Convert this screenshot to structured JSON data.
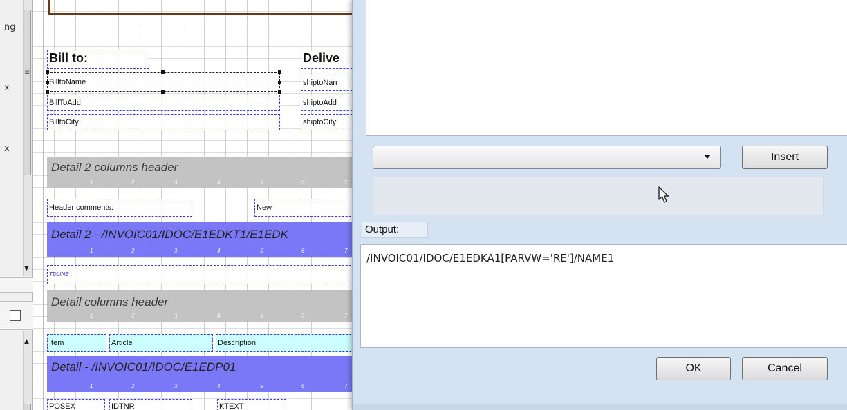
{
  "left_panel": {
    "glyphs": [
      "ng",
      "x",
      "x"
    ]
  },
  "designer": {
    "bill_to_label": "Bill to:",
    "deliver_label": "Delive",
    "bill_fields": [
      "BilltoName",
      "BillToAdd",
      "BilltoCity"
    ],
    "ship_fields": [
      "shiptoNan",
      "shiptoAdd",
      "shiptoCity"
    ],
    "band_detail2_header": "Detail 2 columns header",
    "header_comments_label": "Header comments:",
    "new_label": "New",
    "band_detail2": "Detail 2 - /INVOIC01/IDOC/E1EDKT1/E1EDK",
    "tdline_label": "TDLINE",
    "band_detail_header": "Detail columns header",
    "column_labels": [
      "Item",
      "Article",
      "Description"
    ],
    "band_detail": "Detail - /INVOIC01/IDOC/E1EDP01",
    "detail_fields": [
      "POSEX",
      "IDTNR",
      "KTEXT"
    ],
    "ruler_ticks": [
      "1",
      "2",
      "3",
      "4",
      "5",
      "6",
      "7"
    ]
  },
  "dialog": {
    "combo_value": "",
    "insert_label": "Insert",
    "output_label": "Output:",
    "output_value": "/INVOIC01/IDOC/E1EDKA1[PARVW='RE']/NAME1",
    "ok_label": "OK",
    "cancel_label": "Cancel"
  }
}
